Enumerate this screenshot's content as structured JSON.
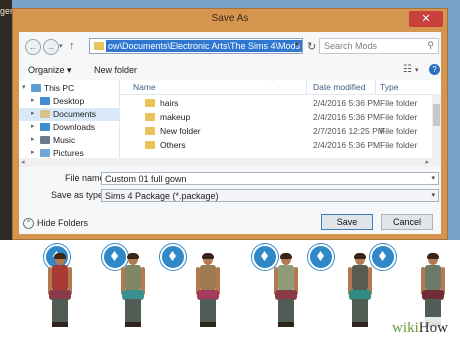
{
  "background_app": {
    "strip_text": "ger"
  },
  "dialog": {
    "title": "Save As",
    "close_label": "✕"
  },
  "nav": {
    "back_glyph": "←",
    "forward_glyph": "→",
    "down_glyph": "▾",
    "up_glyph": "↑",
    "address": "ow\\Documents\\Electronic Arts\\The Sims 4\\Mods",
    "address_dropdown_glyph": "▾",
    "refresh_glyph": "↻",
    "search_placeholder": "Search Mods",
    "search_glyph": "⚲"
  },
  "toolbar": {
    "organize": "Organize ▾",
    "new_folder": "New folder",
    "view_glyph": "☷",
    "view_dropdown_glyph": "▾",
    "help_glyph": "?"
  },
  "navpane": {
    "items": [
      {
        "label": "This PC",
        "expander": "▾"
      },
      {
        "label": "Desktop",
        "expander": "▸"
      },
      {
        "label": "Documents",
        "expander": "▸"
      },
      {
        "label": "Downloads",
        "expander": "▸"
      },
      {
        "label": "Music",
        "expander": "▸"
      },
      {
        "label": "Pictures",
        "expander": "▸"
      }
    ]
  },
  "file_list": {
    "columns": [
      "Name",
      "Date modified",
      "Type"
    ],
    "sort_glyph": "^",
    "rows": [
      {
        "name": "hairs",
        "date": "2/4/2016 5:36 PM",
        "type": "File folder"
      },
      {
        "name": "makeup",
        "date": "2/4/2016 5:36 PM",
        "type": "File folder"
      },
      {
        "name": "New folder",
        "date": "2/7/2016 12:25 PM",
        "type": "File folder"
      },
      {
        "name": "Others",
        "date": "2/4/2016 5:36 PM",
        "type": "File folder"
      }
    ],
    "scroll_left_glyph": "◂",
    "scroll_right_glyph": "▸"
  },
  "form": {
    "file_name_label": "File name:",
    "file_name_value": "Custom 01 full gown",
    "save_type_label": "Save as type:",
    "save_type_value": "Sims 4 Package (*.package)",
    "dropdown_glyph": "▾"
  },
  "footer": {
    "hide_folders_glyph": "^",
    "hide_folders": "Hide Folders",
    "save": "Save",
    "cancel": "Cancel"
  },
  "gowns": {
    "torso_colors": [
      "#a83a36",
      "#7f8664",
      "#9a7a52",
      "#8f9a76",
      "#595a52",
      "#6d7a68"
    ],
    "wrap_colors": [
      "#8a3b4a",
      "#3c8f8f",
      "#a43b5a",
      "#8a3b4a",
      "#2f8a86",
      "#6e2e38"
    ]
  },
  "watermark": {
    "wiki": "wiki",
    "how": "How"
  }
}
